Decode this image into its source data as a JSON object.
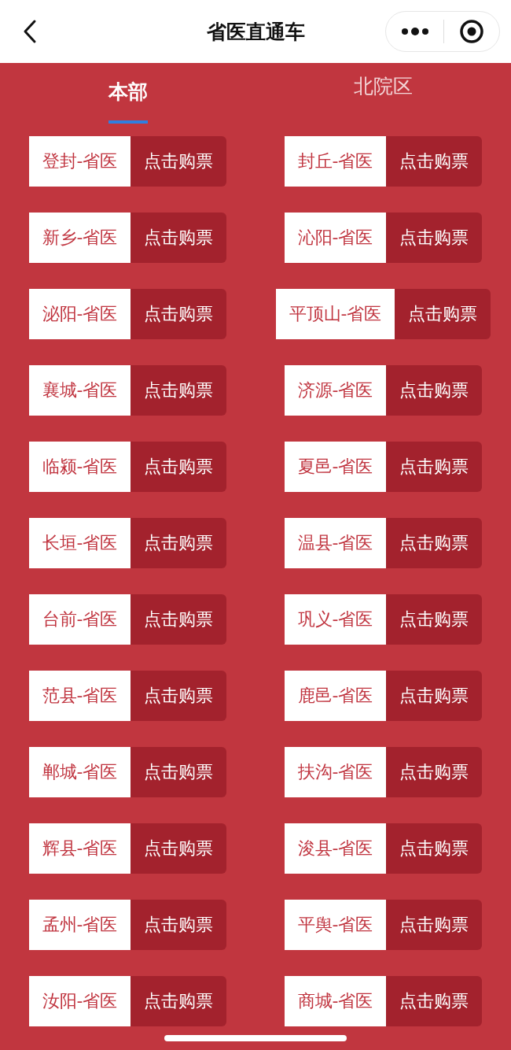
{
  "nav_bar": {
    "title": "省医直通车"
  },
  "tabs": [
    {
      "label": "本部",
      "selected": true
    },
    {
      "label": "北院区",
      "selected": false
    }
  ],
  "routes": [
    {
      "name": "登封-省医",
      "action": "点击购票"
    },
    {
      "name": "封丘-省医",
      "action": "点击购票"
    },
    {
      "name": "新乡-省医",
      "action": "点击购票"
    },
    {
      "name": "沁阳-省医",
      "action": "点击购票"
    },
    {
      "name": "泌阳-省医",
      "action": "点击购票"
    },
    {
      "name": "平顶山-省医",
      "action": "点击购票"
    },
    {
      "name": "襄城-省医",
      "action": "点击购票"
    },
    {
      "name": "济源-省医",
      "action": "点击购票"
    },
    {
      "name": "临颍-省医",
      "action": "点击购票"
    },
    {
      "name": "夏邑-省医",
      "action": "点击购票"
    },
    {
      "name": "长垣-省医",
      "action": "点击购票"
    },
    {
      "name": "温县-省医",
      "action": "点击购票"
    },
    {
      "name": "台前-省医",
      "action": "点击购票"
    },
    {
      "name": "巩义-省医",
      "action": "点击购票"
    },
    {
      "name": "范县-省医",
      "action": "点击购票"
    },
    {
      "name": "鹿邑-省医",
      "action": "点击购票"
    },
    {
      "name": "郸城-省医",
      "action": "点击购票"
    },
    {
      "name": "扶沟-省医",
      "action": "点击购票"
    },
    {
      "name": "辉县-省医",
      "action": "点击购票"
    },
    {
      "name": "浚县-省医",
      "action": "点击购票"
    },
    {
      "name": "孟州-省医",
      "action": "点击购票"
    },
    {
      "name": "平舆-省医",
      "action": "点击购票"
    },
    {
      "name": "汝阳-省医",
      "action": "点击购票"
    },
    {
      "name": "商城-省医",
      "action": "点击购票"
    }
  ]
}
